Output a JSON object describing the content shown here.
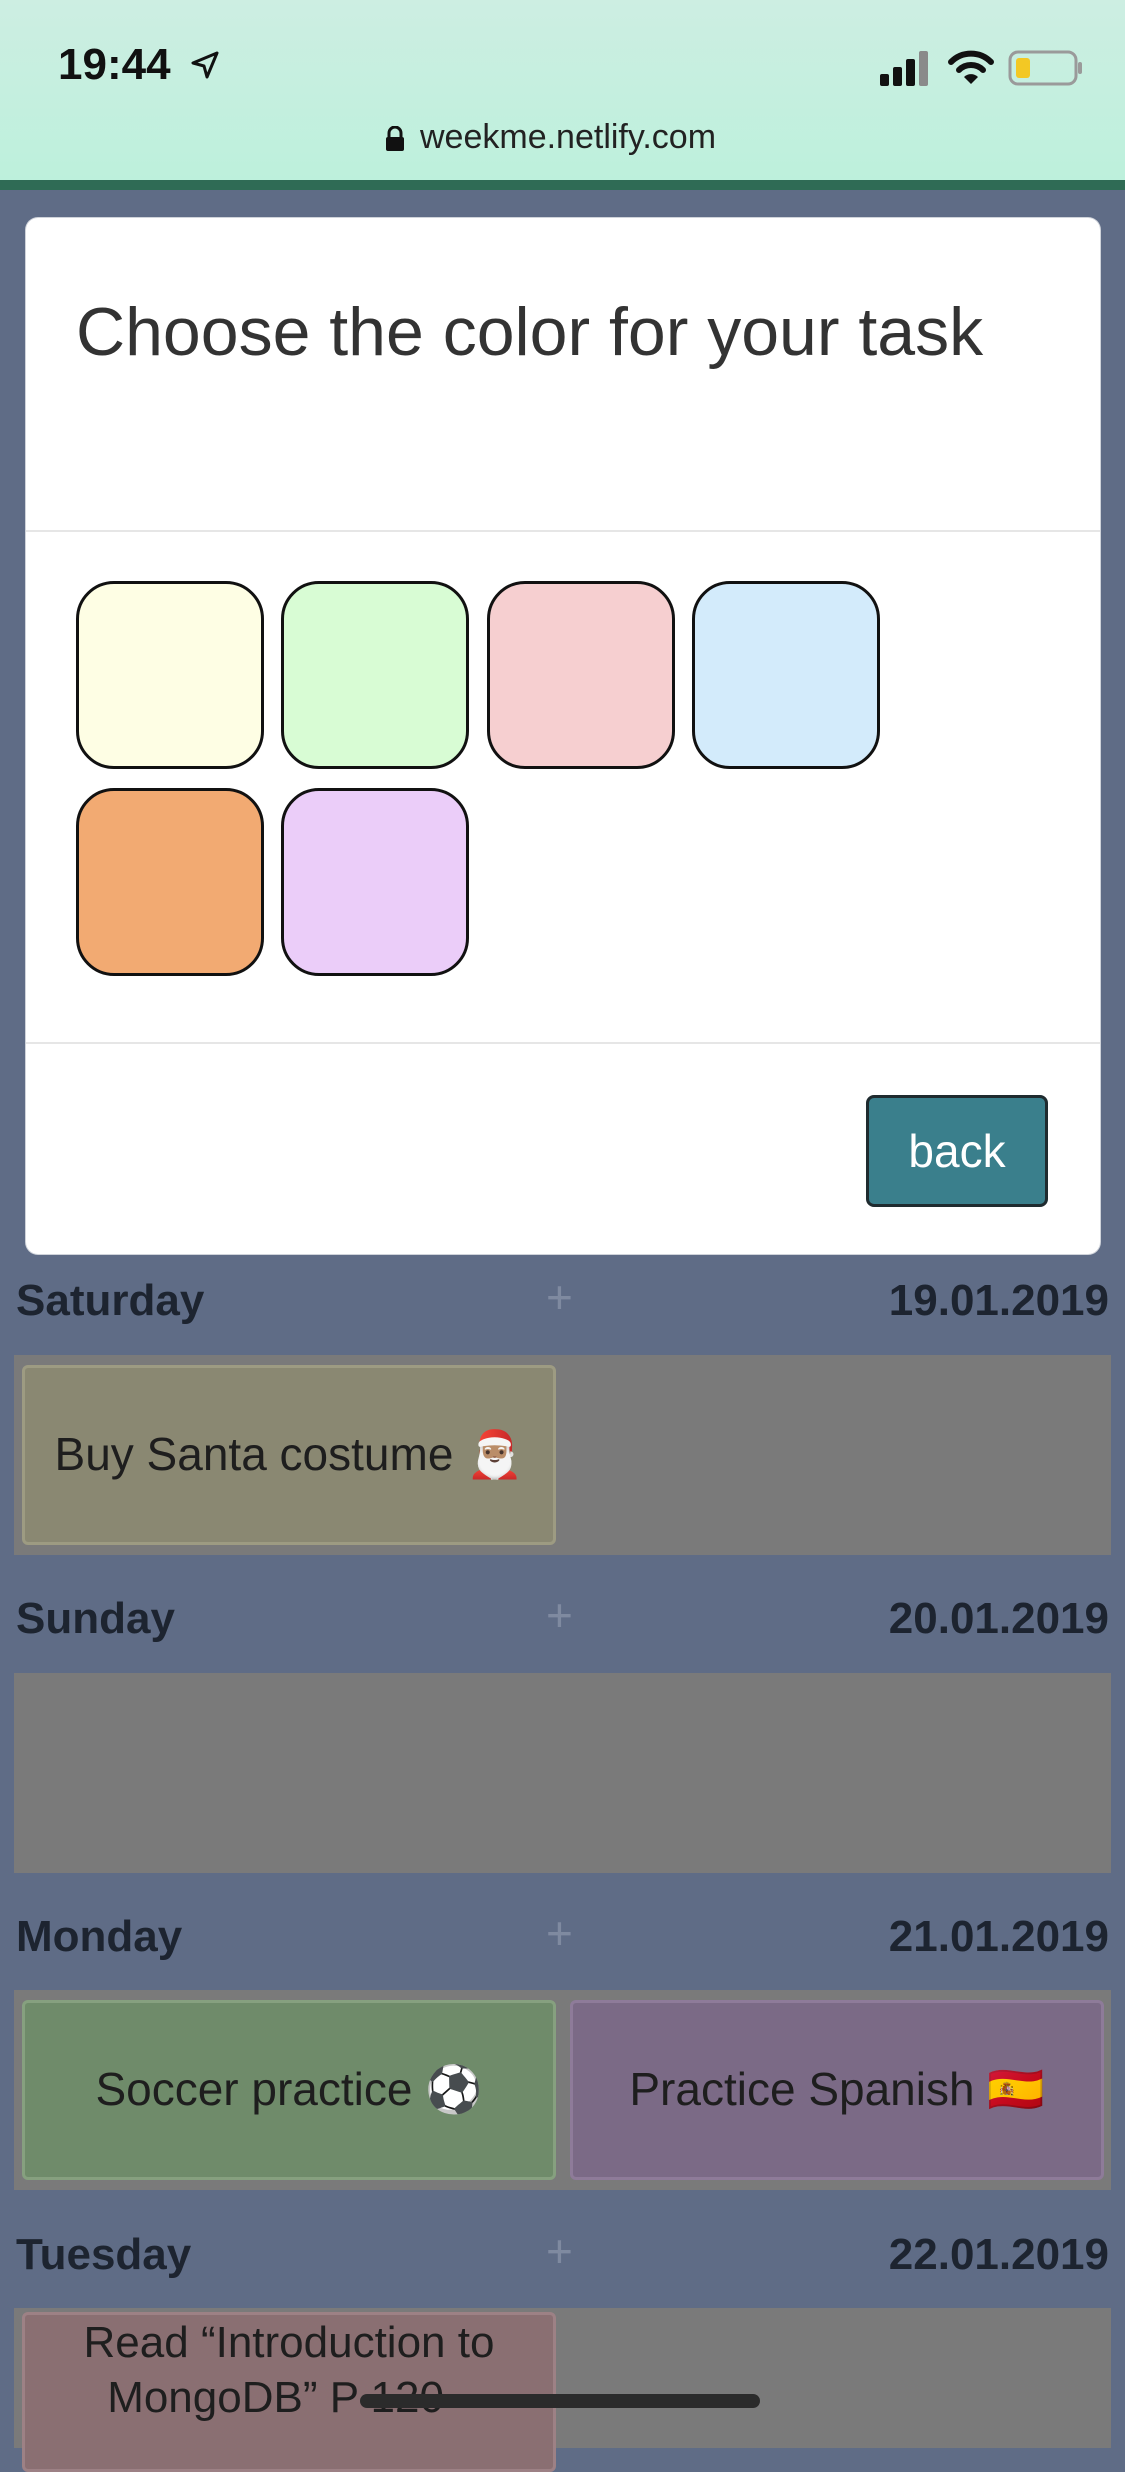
{
  "status_bar": {
    "time": "19:44",
    "location_icon": "location-arrow-icon",
    "signal_icon": "cellular-signal-icon",
    "wifi_icon": "wifi-icon",
    "battery_icon": "battery-low-icon"
  },
  "url_bar": {
    "lock_icon": "lock-icon",
    "url": "weekme.netlify.com"
  },
  "modal": {
    "title": "Choose the color for your task",
    "colors": [
      "#fefee4",
      "#d8fcd4",
      "#f6cfd0",
      "#d3ebfb",
      "#f2aa72",
      "#ebcdf9"
    ],
    "back_label": "back"
  },
  "days": [
    {
      "name": "Saturday",
      "plus": "+",
      "date": "19.01.2019",
      "tasks": [
        {
          "label": "Buy Santa costume 🎅🏽",
          "color": "#fefee4"
        }
      ]
    },
    {
      "name": "Sunday",
      "plus": "+",
      "date": "20.01.2019",
      "tasks": []
    },
    {
      "name": "Monday",
      "plus": "+",
      "date": "21.01.2019",
      "tasks": [
        {
          "label": "Soccer practice ⚽",
          "color": "#d8fcd4"
        },
        {
          "label": "Practice Spanish 🇪🇸",
          "color": "#ebcdf9"
        }
      ]
    },
    {
      "name": "Tuesday",
      "plus": "+",
      "date": "22.01.2019",
      "tasks": [
        {
          "label": "Read “Introduction to MongoDB” P 120 -",
          "color": "#f6cfd0"
        }
      ]
    }
  ]
}
